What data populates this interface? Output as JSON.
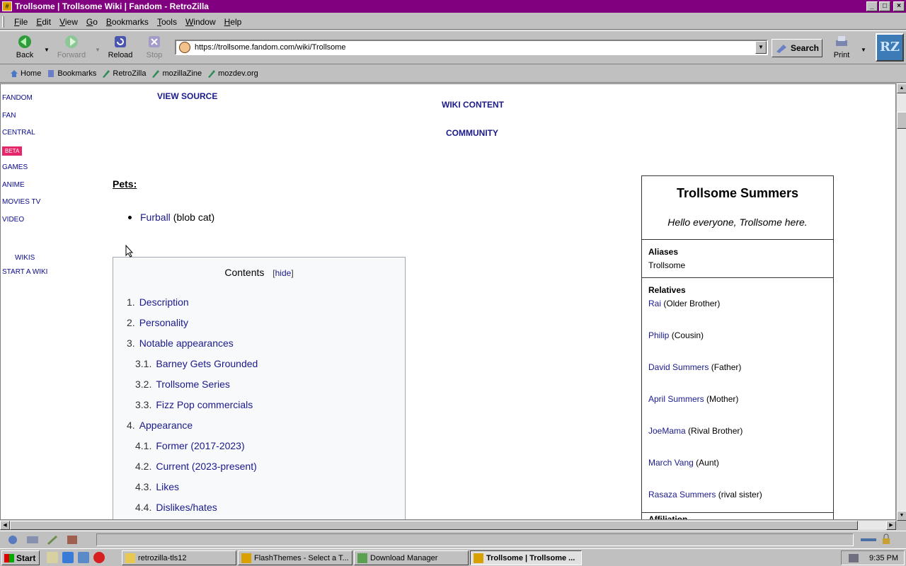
{
  "window": {
    "title": "Trollsome | Trollsome Wiki | Fandom - RetroZilla"
  },
  "menu": [
    "File",
    "Edit",
    "View",
    "Go",
    "Bookmarks",
    "Tools",
    "Window",
    "Help"
  ],
  "nav": {
    "back": "Back",
    "forward": "Forward",
    "reload": "Reload",
    "stop": "Stop",
    "url": "https://trollsome.fandom.com/wiki/Trollsome",
    "search": "Search",
    "print": "Print",
    "logo": "RZ"
  },
  "personal_bar": [
    "Home",
    "Bookmarks",
    "RetroZilla",
    "mozillaZine",
    "mozdev.org"
  ],
  "sidenav": {
    "items": [
      "FANDOM",
      "FAN",
      "CENTRAL",
      "BETA",
      "GAMES",
      "ANIME",
      "MOVIES TV",
      "VIDEO"
    ],
    "wikis": "WIKIS",
    "start": "START A WIKI"
  },
  "header_links": {
    "view_source": "VIEW SOURCE",
    "wiki_content": "WIKI CONTENT",
    "community": "COMMUNITY"
  },
  "pets": {
    "heading": "Pets:",
    "item_link": "Furball",
    "item_note": "(blob cat)"
  },
  "toc": {
    "title": "Contents",
    "hide": "hide",
    "items": [
      {
        "num": "1.",
        "label": "Description",
        "level": 1
      },
      {
        "num": "2.",
        "label": "Personality",
        "level": 1
      },
      {
        "num": "3.",
        "label": "Notable appearances",
        "level": 1
      },
      {
        "num": "3.1.",
        "label": "Barney Gets Grounded",
        "level": 2
      },
      {
        "num": "3.2.",
        "label": "Trollsome Series",
        "level": 2
      },
      {
        "num": "3.3.",
        "label": "Fizz Pop commercials",
        "level": 2
      },
      {
        "num": "4.",
        "label": "Appearance",
        "level": 1
      },
      {
        "num": "4.1.",
        "label": "Former (2017-2023)",
        "level": 2
      },
      {
        "num": "4.2.",
        "label": "Current (2023-present)",
        "level": 2
      },
      {
        "num": "4.3.",
        "label": "Likes",
        "level": 2
      },
      {
        "num": "4.4.",
        "label": "Dislikes/hates",
        "level": 2
      }
    ]
  },
  "infobox": {
    "title": "Trollsome Summers",
    "quote": "Hello everyone, Trollsome here.",
    "aliases_label": "Aliases",
    "aliases_value": "Trollsome",
    "relatives_label": "Relatives",
    "relatives": [
      {
        "name": "Rai",
        "rel": "(Older Brother)"
      },
      {
        "name": "Philip",
        "rel": "(Cousin)"
      },
      {
        "name": "David Summers",
        "rel": "(Father)"
      },
      {
        "name": "April Summers",
        "rel": "(Mother)"
      },
      {
        "name": "JoeMama",
        "rel": "(Rival Brother)"
      },
      {
        "name": "March Vang",
        "rel": "(Aunt)"
      },
      {
        "name": "Rasaza Summers",
        "rel": "(rival sister)"
      }
    ],
    "affiliation_label": "Affiliation"
  },
  "taskbar": {
    "start": "Start",
    "tasks": [
      "retrozilla-tls12",
      "FlashThemes - Select a T...",
      "Download Manager",
      "Trollsome | Trollsome ..."
    ],
    "clock": "9:35 PM"
  },
  "colors": {
    "titlebar": "#800080",
    "link": "#1a1a8c",
    "beta": "#e5266b"
  }
}
